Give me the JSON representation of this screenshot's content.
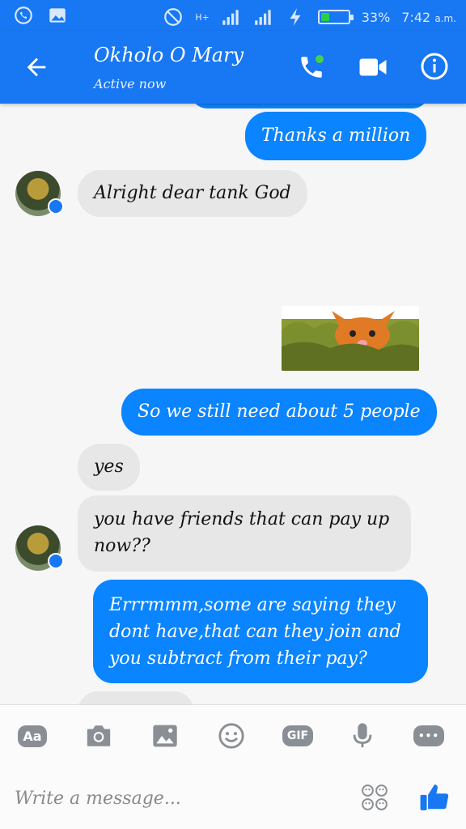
{
  "status_bar": {
    "network": "H+",
    "battery": "33%",
    "battery_level": 0.33,
    "time": "7:42",
    "ampm": "a.m."
  },
  "header": {
    "contact_name": "Okholo O Mary",
    "presence": "Active now"
  },
  "messages": [
    {
      "from": "me",
      "text": "Thanks a million"
    },
    {
      "from": "them",
      "text": "Alright dear tank God"
    },
    {
      "from": "me",
      "type": "sticker"
    },
    {
      "from": "me",
      "text": "So we still need about 5 people"
    },
    {
      "from": "them",
      "text": "yes"
    },
    {
      "from": "them",
      "lines": [
        "you have friends that can pay up",
        "now??"
      ]
    },
    {
      "from": "me",
      "lines": [
        "Errrmmm,some are saying they",
        "dont have,that can they join and",
        "you subtract from their pay?"
      ]
    }
  ],
  "toolbar": {
    "aa_label": "Aa",
    "gif_label": "GIF",
    "more_label": "•••"
  },
  "composer": {
    "placeholder": "Write a message..."
  },
  "colors": {
    "brand_blue": "#1877f2",
    "bubble_out": "#0a84ff",
    "bubble_in": "#e7e7e7",
    "online": "#41d34b",
    "battery_fill": "#26d04a"
  }
}
